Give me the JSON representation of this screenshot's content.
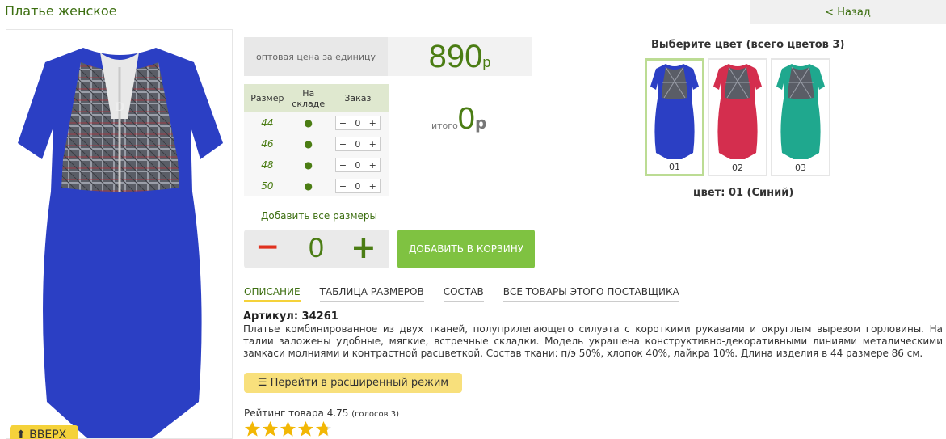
{
  "header": {
    "title": "Платье женское",
    "back_label": "< Назад"
  },
  "photo": {
    "up_label": "⬆ ВВЕРХ"
  },
  "price": {
    "label": "оптовая цена за единицу",
    "value": "890",
    "currency": "р"
  },
  "size_table": {
    "headers": [
      "Размер",
      "На складе",
      "Заказ"
    ],
    "rows": [
      {
        "size": "44",
        "stock": "●",
        "qty": "0"
      },
      {
        "size": "46",
        "stock": "●",
        "qty": "0"
      },
      {
        "size": "48",
        "stock": "●",
        "qty": "0"
      },
      {
        "size": "50",
        "stock": "●",
        "qty": "0"
      }
    ],
    "minus": "−",
    "plus": "+"
  },
  "total": {
    "label": "итого",
    "value": "0",
    "currency": "р"
  },
  "add_all_label": "Добавить все размеры",
  "big_stepper": {
    "minus": "−",
    "value": "0",
    "plus": "+"
  },
  "cart_button_label": "ДОБАВИТЬ В КОРЗИНУ",
  "colors": {
    "title": "Выберите цвет (всего цветов 3)",
    "swatches": [
      {
        "label": "01",
        "color": "#2b3fc4"
      },
      {
        "label": "02",
        "color": "#d42e4e"
      },
      {
        "label": "03",
        "color": "#1fa88e"
      }
    ],
    "selected": "цвет: 01 (Синий)"
  },
  "tabs": [
    "ОПИСАНИЕ",
    "ТАБЛИЦА РАЗМЕРОВ",
    "СОСТАВ",
    "ВСЕ ТОВАРЫ ЭТОГО ПОСТАВЩИКА"
  ],
  "article": "Артикул: 34261",
  "description": "Платье комбинированное из двух тканей, полуприлегающего силуэта с короткими рукавами и округлым вырезом горловины. На талии заложены удобные, мягкие, встречные складки. Модель украшена конструктивно-декоративными линиями металическими замкаси молниями и контрастной расцветкой. Состав ткани: п/э 50%, хлопок 40%, лайкра 10%. Длина изделия в 44 размере 86 см.",
  "adv_mode_label": "☰ Перейти в расширенный режим",
  "rating": {
    "text": "Рейтинг товара 4.75",
    "votes": "(голосов 3)",
    "value": 4.75
  },
  "accent": "#4b7d14"
}
